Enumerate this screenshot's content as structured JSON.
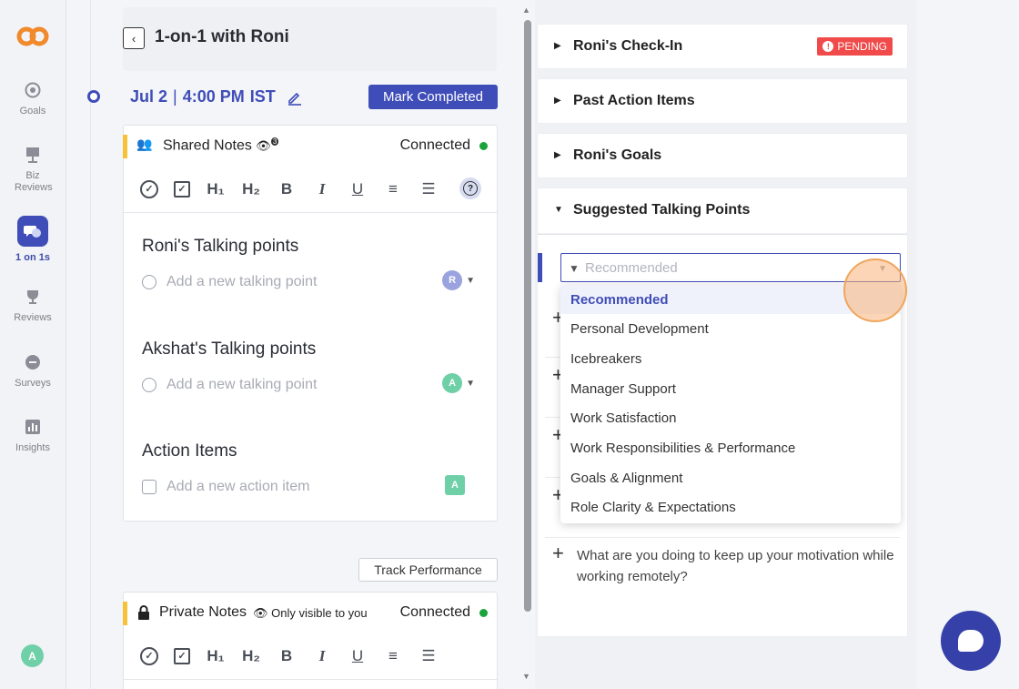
{
  "sidebar": {
    "items": [
      {
        "label": "Goals",
        "icon": "target-icon"
      },
      {
        "label": "Biz Reviews",
        "icon": "presentation-icon"
      },
      {
        "label": "1 on 1s",
        "icon": "chat-icon",
        "active": true
      },
      {
        "label": "Reviews",
        "icon": "trophy-icon"
      },
      {
        "label": "Surveys",
        "icon": "survey-icon"
      },
      {
        "label": "Insights",
        "icon": "chart-icon"
      }
    ],
    "user_initial": "A"
  },
  "header": {
    "title": "1-on-1 with Roni",
    "back_icon": "‹"
  },
  "meeting": {
    "date": "Jul 2",
    "separator": "|",
    "time": "4:00 PM",
    "tz": "IST",
    "mark_completed": "Mark Completed"
  },
  "shared_notes": {
    "title": "Shared Notes",
    "viewers_count": "3",
    "status": "Connected",
    "toolbar": [
      "✓",
      "☑",
      "H₁",
      "H₂",
      "B",
      "I",
      "U",
      "≡",
      "☰"
    ],
    "sections": [
      {
        "title": "Roni's Talking points",
        "placeholder": "Add a new talking point",
        "avatar": "R",
        "avatar_color": "#9aa3de"
      },
      {
        "title": "Akshat's Talking points",
        "placeholder": "Add a new talking point",
        "avatar": "A",
        "avatar_color": "#6fd0a8"
      },
      {
        "title": "Action Items",
        "placeholder": "Add a new action item",
        "avatar": "A",
        "avatar_color": "#6fd0a8"
      }
    ]
  },
  "track_performance": "Track Performance",
  "private_notes": {
    "title": "Private Notes",
    "visibility": "Only visible to you",
    "status": "Connected"
  },
  "right_panels": [
    {
      "title": "Roni's Check-In",
      "badge": "PENDING"
    },
    {
      "title": "Past Action Items"
    },
    {
      "title": "Roni's Goals"
    },
    {
      "title": "Suggested Talking Points",
      "expanded": true
    }
  ],
  "filter": {
    "placeholder": "Recommended",
    "options": [
      "Recommended",
      "Personal Development",
      "Icebreakers",
      "Manager Support",
      "Work Satisfaction",
      "Work Responsibilities & Performance",
      "Goals & Alignment",
      "Role Clarity & Expectations"
    ],
    "selected": "Recommended"
  },
  "talking_points": [
    {
      "text": "What are you doing to keep up your motivation while working remotely?"
    }
  ],
  "colors": {
    "accent": "#3f4db8",
    "pending": "#f04a4a",
    "connected": "#19a33a",
    "note_accent": "#f7c23a"
  }
}
